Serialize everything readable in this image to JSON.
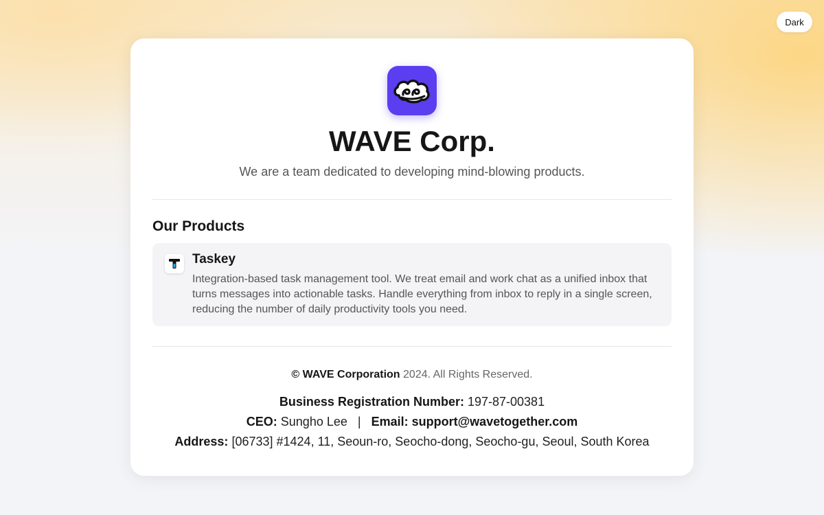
{
  "theme_toggle": {
    "label": "Dark"
  },
  "company": {
    "name": "WAVE Corp.",
    "tagline": "We are a team dedicated to developing mind-blowing products.",
    "logo_icon": "wave-cloud-logo-icon",
    "brand_color": "#5b3ef0"
  },
  "products": {
    "heading": "Our Products",
    "items": [
      {
        "name": "Taskey",
        "icon": "taskey-t-icon",
        "description": "Integration-based task management tool. We treat email and work chat as a unified inbox that turns messages into actionable tasks. Handle everything from inbox to reply in a single screen, reducing the number of daily productivity tools you need."
      }
    ]
  },
  "footer": {
    "copyright_symbol": "©",
    "copyright_company": "WAVE Corporation",
    "copyright_rest": "2024. All Rights Reserved.",
    "brn_label": "Business Registration Number:",
    "brn_value": "197-87-00381",
    "ceo_label": "CEO:",
    "ceo_value": "Sungho Lee",
    "separator": "|",
    "email_label": "Email:",
    "email_value": "support@wavetogether.com",
    "address_label": "Address:",
    "address_value": "[06733] #1424, 11, Seoun-ro, Seocho-dong, Seocho-gu, Seoul, South Korea"
  }
}
